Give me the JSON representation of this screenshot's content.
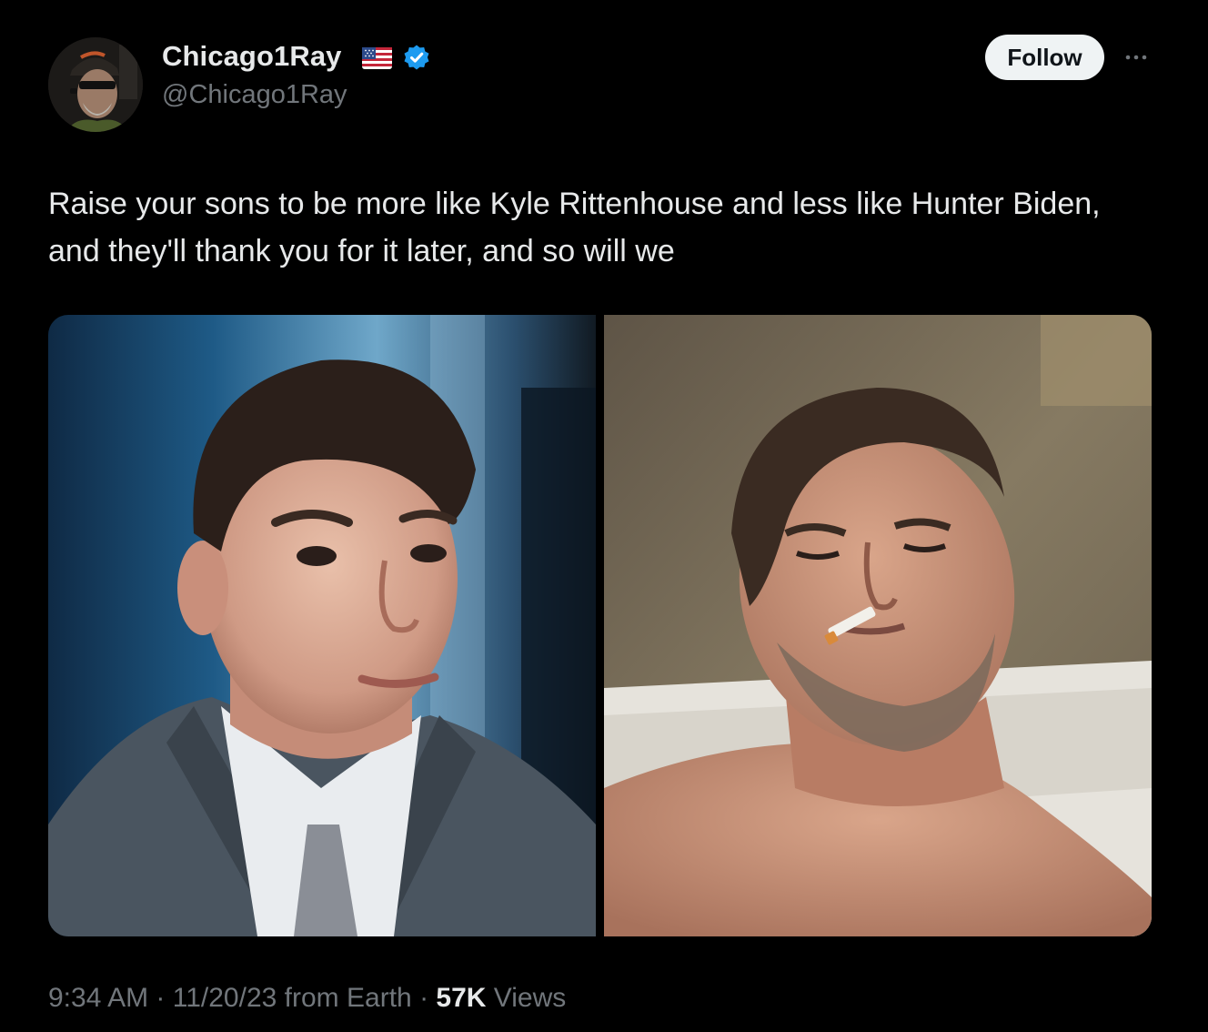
{
  "author": {
    "display_name": "Chicago1Ray",
    "handle": "@Chicago1Ray",
    "verified": true,
    "flag_icon": "us-flag-icon",
    "verified_color": "#1d9bf0"
  },
  "actions": {
    "follow_label": "Follow",
    "more_icon": "ellipsis-icon"
  },
  "tweet": {
    "text": "Raise your sons to be more like Kyle Rittenhouse and less like Hunter Biden, and they'll thank you for it later, and so will we"
  },
  "media": {
    "count": 2
  },
  "meta": {
    "time": "9:34 AM",
    "separator": "·",
    "date": "11/20/23",
    "source": "from Earth",
    "views_count": "57K",
    "views_label": "Views"
  },
  "colors": {
    "background": "#000000",
    "primary_text": "#e7e9ea",
    "secondary_text": "#71767b",
    "follow_bg": "#eff3f4"
  }
}
